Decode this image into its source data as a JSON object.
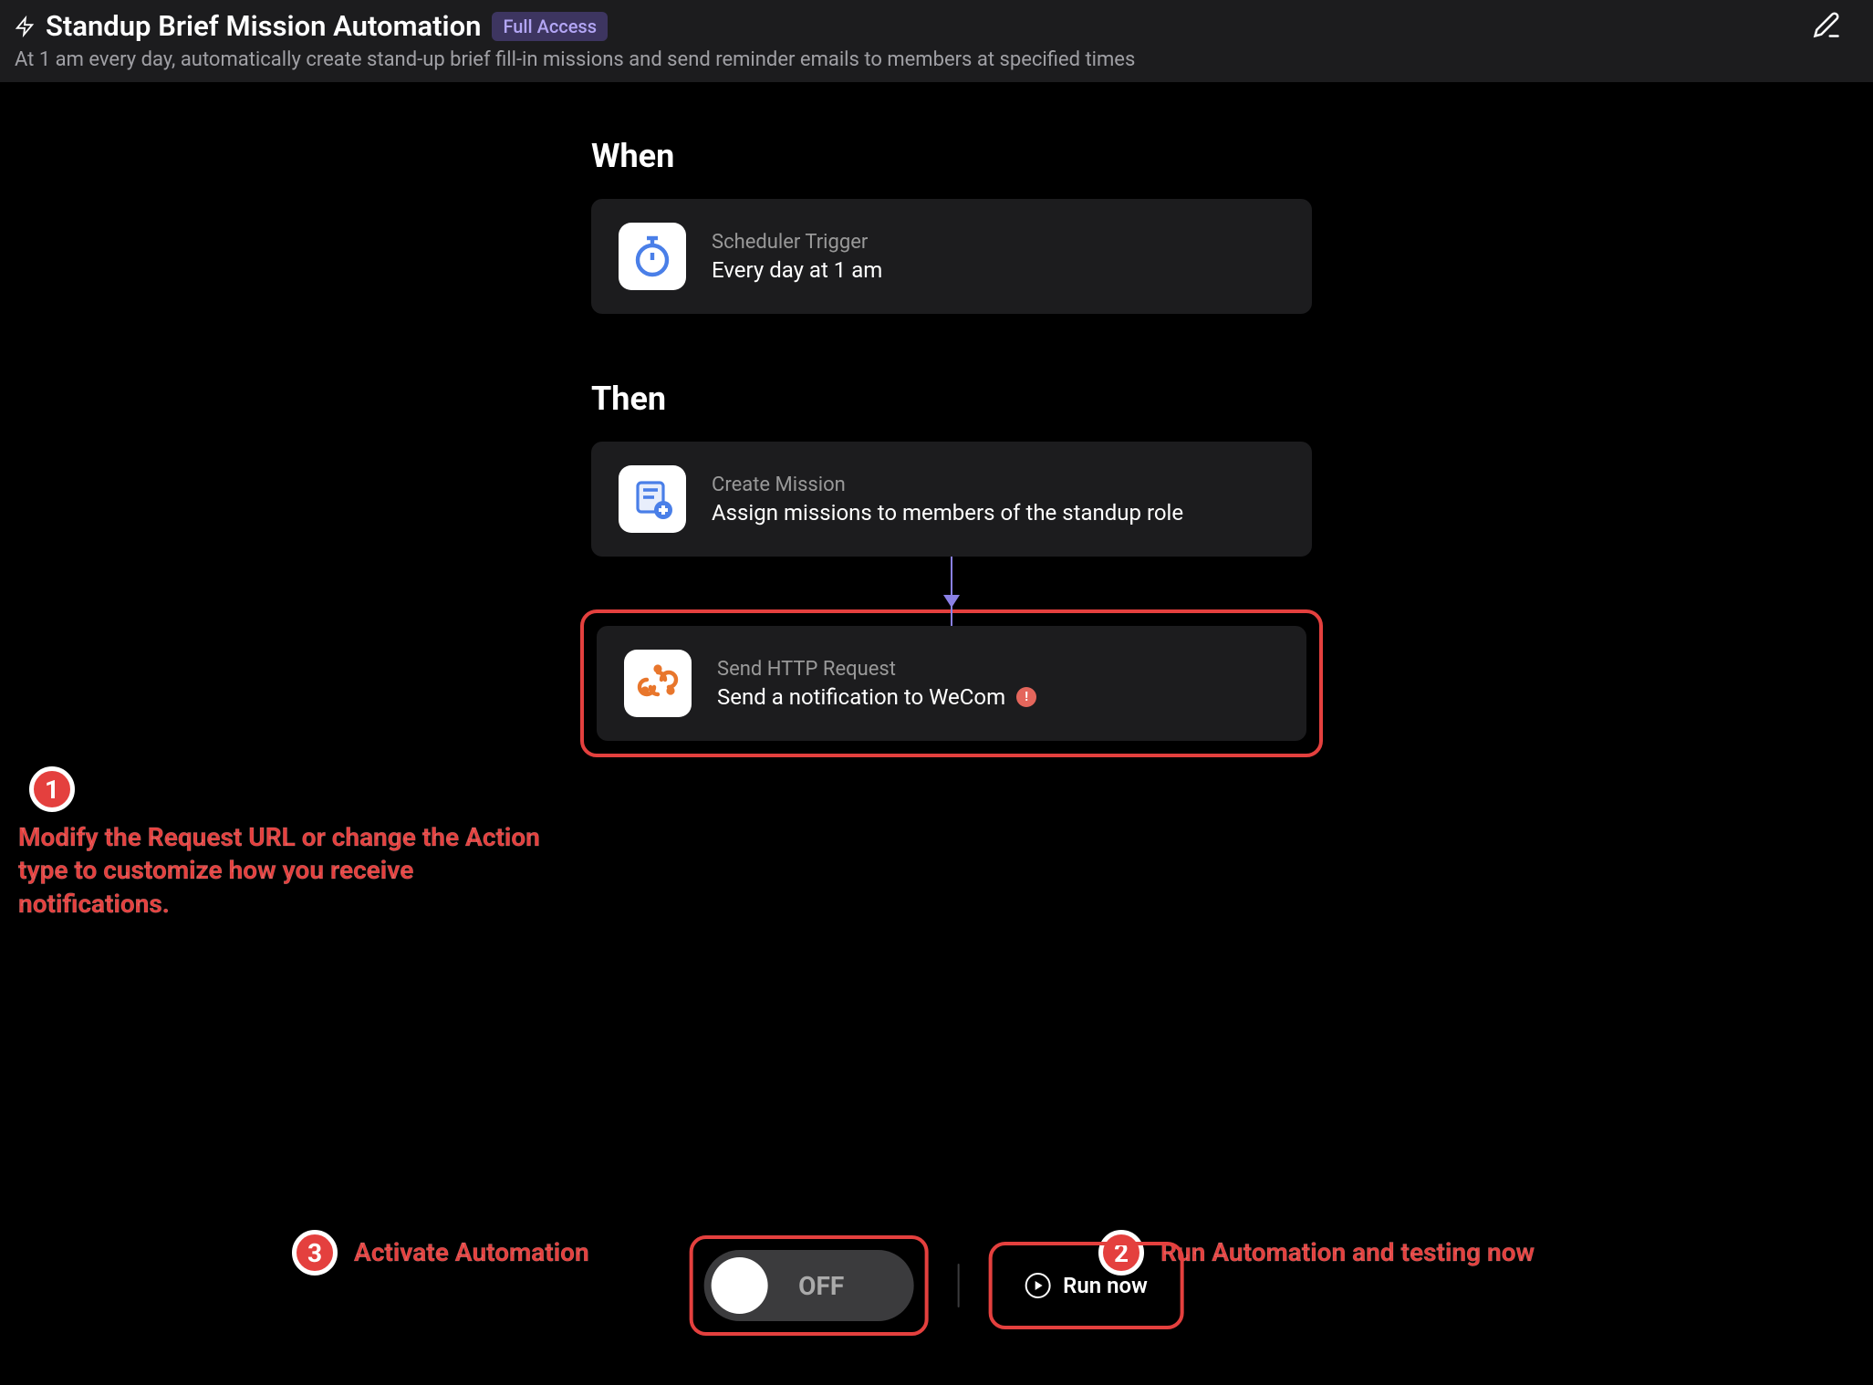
{
  "header": {
    "title": "Standup Brief Mission Automation",
    "badge": "Full Access",
    "subtitle": "At 1 am every day, automatically create stand-up brief fill-in missions and send reminder emails to members at specified times"
  },
  "flow": {
    "when_label": "When",
    "then_label": "Then",
    "trigger": {
      "title": "Scheduler Trigger",
      "desc": "Every day at 1 am"
    },
    "action1": {
      "title": "Create Mission",
      "desc": "Assign missions to members of the standup role"
    },
    "action2": {
      "title": "Send HTTP Request",
      "desc": "Send a notification to WeCom"
    }
  },
  "callouts": {
    "c1": {
      "num": "1",
      "text": "Modify the Request URL or change the Action type to customize how you receive notifications."
    },
    "c2": {
      "num": "2",
      "text": "Run Automation and testing now"
    },
    "c3": {
      "num": "3",
      "text": "Activate Automation"
    }
  },
  "controls": {
    "toggle_label": "OFF",
    "run_label": "Run now"
  }
}
